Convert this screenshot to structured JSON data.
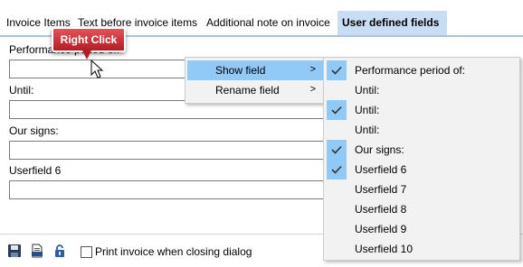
{
  "tabs": [
    {
      "label": "Invoice Items",
      "active": false
    },
    {
      "label": "Text before invoice items",
      "active": false
    },
    {
      "label": "Additional note on invoice",
      "active": false
    },
    {
      "label": "User defined fields",
      "active": true
    }
  ],
  "fields": [
    {
      "label": "Performance period of:",
      "value": ""
    },
    {
      "label": "Until:",
      "value": ""
    },
    {
      "label": "Our signs:",
      "value": ""
    },
    {
      "label": "Userfield 6",
      "value": ""
    }
  ],
  "callout": {
    "text": "Right Click"
  },
  "context_menu": {
    "items": [
      {
        "label": "Show field",
        "highlighted": true,
        "arrow": ">"
      },
      {
        "label": "Rename field",
        "highlighted": false,
        "arrow": ">"
      }
    ]
  },
  "submenu": {
    "items": [
      {
        "label": "Performance period of:",
        "checked": true
      },
      {
        "label": "Until:",
        "checked": false
      },
      {
        "label": "Until:",
        "checked": true
      },
      {
        "label": "Until:",
        "checked": false
      },
      {
        "label": "Our signs:",
        "checked": true
      },
      {
        "label": "Userfield 6",
        "checked": true
      },
      {
        "label": "Userfield 7",
        "checked": false
      },
      {
        "label": "Userfield 8",
        "checked": false
      },
      {
        "label": "Userfield 9",
        "checked": false
      },
      {
        "label": "Userfield 10",
        "checked": false
      }
    ]
  },
  "toolbar": {
    "icons": [
      "save-icon",
      "print-preview-icon",
      "unlock-icon"
    ]
  },
  "footer": {
    "print_on_close_label": "Print invoice when closing dialog",
    "print_on_close_checked": false
  },
  "colors": {
    "tab_active_bg": "#c9def5",
    "highlight": "#91c9f7",
    "callout_red": "#c8262e"
  }
}
